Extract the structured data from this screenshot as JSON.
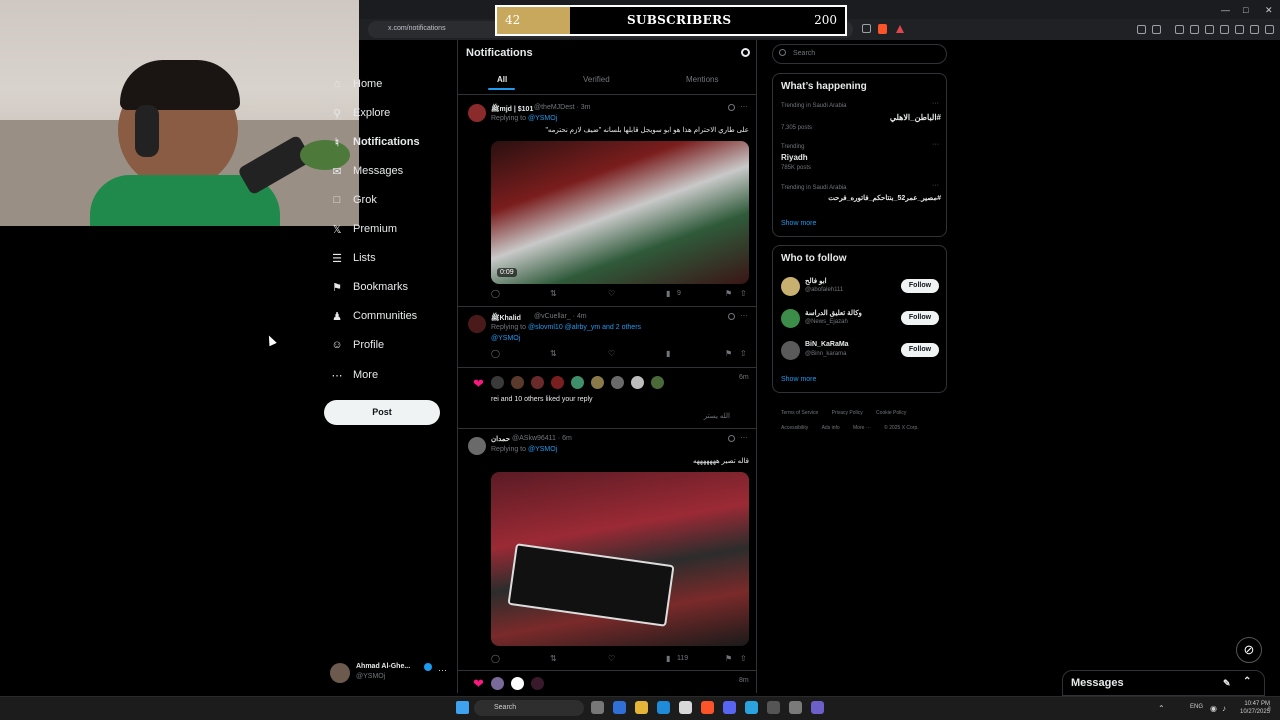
{
  "browser": {
    "url": "x.com/notifications"
  },
  "stream": {
    "subscribers": {
      "current": "42",
      "label": "SUBSCRIBERS",
      "goal": "200",
      "progress": 0.21
    }
  },
  "nav": {
    "items": [
      {
        "label": "Home",
        "icon": "home-icon"
      },
      {
        "label": "Explore",
        "icon": "search-icon"
      },
      {
        "label": "Notifications",
        "icon": "bell-icon"
      },
      {
        "label": "Messages",
        "icon": "mail-icon"
      },
      {
        "label": "Grok",
        "icon": "grok-icon"
      },
      {
        "label": "Premium",
        "icon": "x-logo-icon"
      },
      {
        "label": "Lists",
        "icon": "list-icon"
      },
      {
        "label": "Bookmarks",
        "icon": "bookmark-icon"
      },
      {
        "label": "Communities",
        "icon": "people-icon"
      },
      {
        "label": "Profile",
        "icon": "person-icon"
      },
      {
        "label": "More",
        "icon": "more-circle-icon"
      }
    ],
    "post_label": "Post",
    "account": {
      "name": "Ahmad Al-Ghe...",
      "handle": "@YSMOj"
    }
  },
  "notifications": {
    "title": "Notifications",
    "tabs": [
      "All",
      "Verified",
      "Mentions"
    ],
    "items": [
      {
        "name": "ﷺmjd | $101",
        "handle": "@theMJDest · 3m",
        "reply_prefix": "Replying to",
        "reply_to": "@YSMOj",
        "text": "على طاري الاحترام هذا هو ابو سويجل قابلها بلسانه \"ضيف لازم نحترمه\"",
        "video_time": "0:09",
        "views": "9"
      },
      {
        "name": "ﷺKhalid",
        "handle": "@vCuellar_ · 4m",
        "reply_prefix": "Replying to",
        "reply_to": "@slovml10 @alrby_ym and 2 others",
        "reply_to2": "@YSMOj"
      },
      {
        "time": "6m",
        "text": "rei and 10 others liked your reply",
        "quote": "الله يستر"
      },
      {
        "name": "حمدان",
        "handle": "@ASkw96411 · 6m",
        "reply_prefix": "Replying to",
        "reply_to": "@YSMOj",
        "text": "قاله تصير هههههههه",
        "views": "119"
      },
      {
        "time": "8m"
      }
    ]
  },
  "sidebar": {
    "search_placeholder": "Search",
    "happening_title": "What’s happening",
    "trends": [
      {
        "context": "Trending in Saudi Arabia",
        "title": "#الباطن_الاهلي",
        "posts": "7,305 posts"
      },
      {
        "context": "Trending",
        "title": "Riyadh",
        "posts": "785K posts"
      },
      {
        "context": "Trending in Saudi Arabia",
        "title": "#مصير_عمر52_بنتاحكم_فاتوره_فرحت",
        "posts": ""
      }
    ],
    "show_more": "Show more",
    "follow_title": "Who to follow",
    "follow": [
      {
        "name": "ابو فالح",
        "handle": "@abofaleh111",
        "button": "Follow"
      },
      {
        "name": "وكالة تعليق الدراسة",
        "handle": "@News_Ejazah",
        "button": "Follow"
      },
      {
        "name": "BiN_KaRaMa",
        "handle": "@Binn_karama",
        "button": "Follow"
      }
    ],
    "follow_more": "Show more",
    "footer": [
      "Terms of Service",
      "Privacy Policy",
      "Cookie Policy",
      "Accessibility",
      "Ads info",
      "More ···",
      "© 2025 X Corp."
    ]
  },
  "messages_label": "Messages",
  "taskbar": {
    "search_placeholder": "Search",
    "lang": "ENG",
    "time": "10:47 PM",
    "date": "10/27/2025"
  },
  "colors": {
    "accent": "#1d9bf0",
    "like": "#f91880",
    "subbar_fill": "#c8a85c"
  }
}
